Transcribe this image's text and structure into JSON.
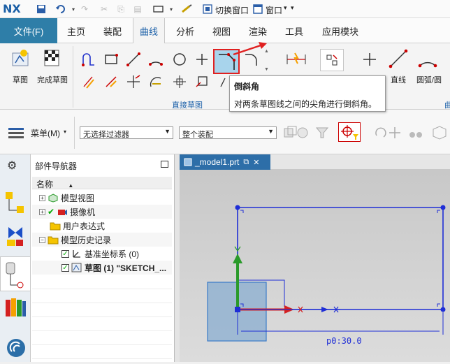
{
  "app": {
    "logo": "NX"
  },
  "quick_access": {
    "switch_window": "切换窗口",
    "window": "窗口"
  },
  "ribbon_tabs": {
    "file": "文件(F)",
    "home": "主页",
    "assembly": "装配",
    "curve": "曲线",
    "analysis": "分析",
    "view": "视图",
    "render": "渲染",
    "tools": "工具",
    "app_module": "应用模块"
  },
  "ribbon": {
    "sketch": "草图",
    "finish_sketch": "完成草图",
    "direct_sketch_group": "直接草图",
    "line": "直线",
    "arc_circle": "圆弧/圆",
    "group_curve_partial": "曲"
  },
  "tooltip": {
    "title": "倒斜角",
    "description": "对两条草图线之间的尖角进行倒斜角。"
  },
  "selection_bar": {
    "menu": "菜单(M)",
    "filter": "无选择过滤器",
    "scope": "整个装配"
  },
  "navigator": {
    "title": "部件导航器",
    "column_name": "名称",
    "items": [
      {
        "label": "模型视图"
      },
      {
        "label": "摄像机"
      },
      {
        "label": "用户表达式"
      },
      {
        "label": "模型历史记录"
      },
      {
        "label": "基准坐标系 (0)"
      },
      {
        "label": "草图 (1) \"SKETCH_..."
      }
    ]
  },
  "document": {
    "tab": "_model1.prt",
    "dimension": "p0:30.0"
  },
  "colors": {
    "file_tab": "#2e7ea8",
    "active_tab_text": "#1a5fa8",
    "sketch_line": "#1f2ed6",
    "highlight_box": "#e02020",
    "axis_green": "#2a9a2a",
    "axis_red": "#d42020"
  }
}
